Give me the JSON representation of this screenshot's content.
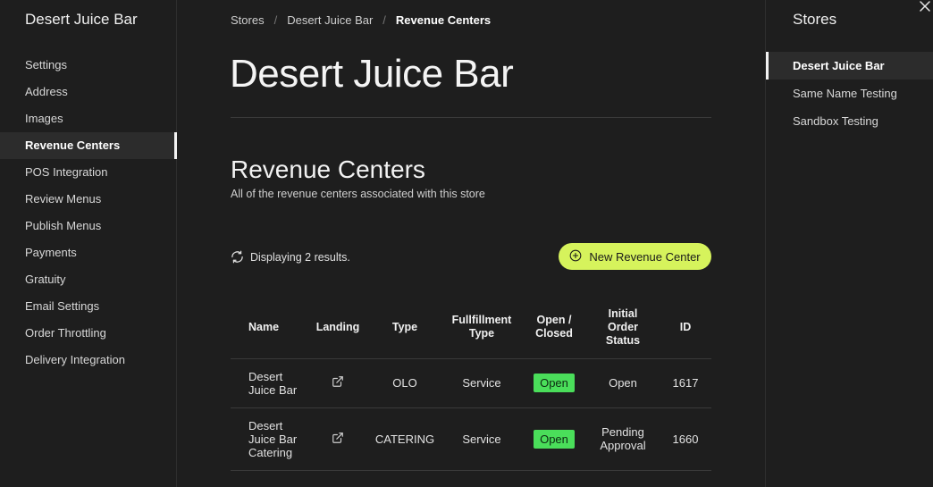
{
  "sidebar": {
    "brand": "Desert Juice Bar",
    "items": [
      {
        "label": "Settings"
      },
      {
        "label": "Address"
      },
      {
        "label": "Images"
      },
      {
        "label": "Revenue Centers",
        "active": true
      },
      {
        "label": "POS Integration"
      },
      {
        "label": "Review Menus"
      },
      {
        "label": "Publish Menus"
      },
      {
        "label": "Payments"
      },
      {
        "label": "Gratuity"
      },
      {
        "label": "Email Settings"
      },
      {
        "label": "Order Throttling"
      },
      {
        "label": "Delivery Integration"
      }
    ]
  },
  "breadcrumb": {
    "items": [
      "Stores",
      "Desert Juice Bar",
      "Revenue Centers"
    ],
    "separator": "/"
  },
  "page": {
    "title": "Desert Juice Bar",
    "section_title": "Revenue Centers",
    "section_subtitle": "All of the revenue centers associated with this store",
    "results_text": "Displaying 2 results.",
    "new_button_label": "New Revenue Center",
    "accent_color": "#d6f35c",
    "open_badge_color": "#4ade5a"
  },
  "table": {
    "headers": {
      "name": "Name",
      "landing": "Landing",
      "type": "Type",
      "fulfillment_line1": "Fullfillment",
      "fulfillment_line2": "Type",
      "open_line1": "Open /",
      "open_line2": "Closed",
      "status_line1": "Initial",
      "status_line2": "Order",
      "status_line3": "Status",
      "id": "ID"
    },
    "rows": [
      {
        "name_lines": [
          "Desert",
          "Juice Bar"
        ],
        "type": "OLO",
        "fulfillment": "Service",
        "open": "Open",
        "status_lines": [
          "Open"
        ],
        "id": "1617"
      },
      {
        "name_lines": [
          "Desert",
          "Juice Bar",
          "Catering"
        ],
        "type": "CATERING",
        "fulfillment": "Service",
        "open": "Open",
        "status_lines": [
          "Pending",
          "Approval"
        ],
        "id": "1660"
      }
    ]
  },
  "stores_panel": {
    "title": "Stores",
    "items": [
      {
        "label": "Desert Juice Bar",
        "active": true
      },
      {
        "label": "Same Name Testing"
      },
      {
        "label": "Sandbox Testing"
      }
    ]
  },
  "icons": {
    "refresh": "refresh-icon",
    "add": "plus-circle-icon",
    "landing": "external-link-icon",
    "close": "close-icon"
  }
}
